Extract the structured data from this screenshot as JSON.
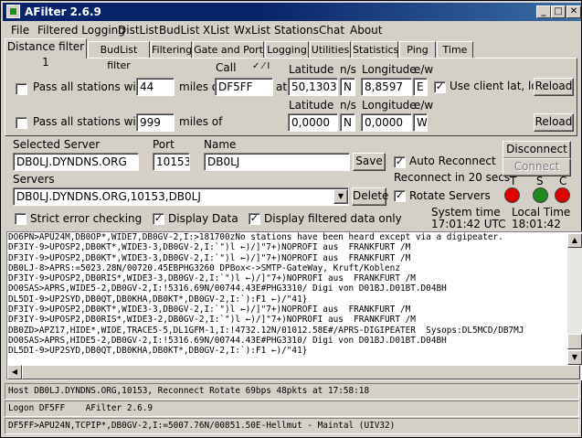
{
  "window": {
    "title": "AFilter 2.6.9"
  },
  "menu": [
    "File",
    "Filtered Logging",
    "DistList",
    "BudList",
    "XList",
    "WxList",
    "Stations",
    "Chat",
    "About"
  ],
  "tabs": [
    "Distance filter 1",
    "BudList filter",
    "Filtering",
    "Gate and Port",
    "Logging",
    "Utilities",
    "Statistics",
    "Ping",
    "Time"
  ],
  "distance": {
    "call_label": "Call",
    "call_hint": "✓ ⁄ I",
    "lat_label": "Latitude",
    "lon_label": "Longitude",
    "ns_label": "n/s",
    "ew_label": "e/w",
    "row1": {
      "pass_label": "Pass all stations within",
      "miles": "44",
      "miles_of": "miles of",
      "call": "DF5FF",
      "at": "at",
      "lat": "50,1303",
      "ns": "N",
      "lon": "8,8597",
      "ew": "E",
      "use_client_label": "Use client lat, lon",
      "use_client_checked": true,
      "reload": "Reload"
    },
    "row2": {
      "pass_label": "Pass all stations within",
      "miles": "999",
      "miles_of": "miles of",
      "lat": "0,0000",
      "ns": "N",
      "lon": "0,0000",
      "ew": "W",
      "reload": "Reload"
    }
  },
  "server": {
    "selected_label": "Selected Server",
    "selected_value": "DB0LJ.DYNDNS.ORG",
    "port_label": "Port",
    "port_value": "10153",
    "name_label": "Name",
    "name_value": "DB0LJ",
    "save_label": "Save",
    "servers_label": "Servers",
    "servers_value": "DB0LJ.DYNDNS.ORG,10153,DB0LJ",
    "delete_label": "Delete",
    "disconnect_label": "Disconnect",
    "connect_label": "Connect",
    "auto_reconnect_label": "Auto Reconnect",
    "reconnect_text": "Reconnect in 20 secs",
    "rotate_label": "Rotate Servers",
    "led_labels": [
      "T",
      "S",
      "C"
    ],
    "led_colors": [
      "#e00000",
      "#1e8a1e",
      "#e00000"
    ]
  },
  "options": {
    "strict_label": "Strict error checking",
    "display_data_label": "Display Data",
    "display_filtered_label": "Display filtered data only",
    "system_time_label": "System time",
    "system_time_value": "17:01:42 UTC",
    "local_time_label": "Local Time",
    "local_time_value": "18:01:42"
  },
  "log": [
    "DO6PN>APU24M,DB0OP*,WIDE7,DB0GV-2,I:>181700zNo stations have been heard except via a digipeater.",
    "DF3IY-9>UPOSP2,DB0KT*,WIDE3-3,DB0GV-2,I:`\")l ←)/]\"7+)NOPROFI aus  FRANKFURT /M",
    "DF3IY-9>UPOSP2,DB0KT*,WIDE3-3,DB0GV-2,I:`\")l ←)/]\"7+)NOPROFI aus  FRANKFURT /M",
    "DB0LJ-8>APRS:=5023.28N/00720.45EBPHG3260 DPBox<->SMTP-GateWay, Kruft/Koblenz",
    "DF3IY-9>UPOSP2,DB0RIS*,WIDE3-3,DB0GV-2,I:`\")l ←)/]\"7+)NOPROFI aus  FRANKFURT /M",
    "DO0SAS>APRS,WIDE5-2,DB0GV-2,I:!5316.69N/00744.43E#PHG3310/ Digi von D01BJ.D01BT.D04BH",
    "DL5DI-9>UP2SYD,DB0QT,DB0KHA,DB0KT*,DB0GV-2,I:`):F1 ←)/\"41}",
    "DF3IY-9>UPOSP2,DB0KT*,WIDE3-3,DB0GV-2,I:`\")l ←)/]\"7+)NOPROFI aus  FRANKFURT /M",
    "DF3IY-9>UPOSP2,DB0RIS*,WIDE3-2,DB0GV-2,I:`\")l ←)/]\"7+)NOPROFI aus  FRANKFURT /M",
    "DB0ZD>APZ17,HIDE*,WIDE,TRACE5-5,DL1GFM-1,I:!4732.12N/01012.58E#/APRS-DIGIPEATER  Sysops:DL5MCD/DB7MJ",
    "DO0SAS>APRS,HIDE5-2,DB0GV-2,I:!5316.69N/00744.43E#PHG3310/ Digi von D01BJ.D01BT.D04BH",
    "DL5DI-9>UP2SYD,DB0QT,DB0KHA,DB0KT*,DB0GV-2,I:`):F1 ←)/\"41}"
  ],
  "status": [
    "Host DB0LJ.DYNDNS.ORG,10153, Reconnect Rotate 69bps 48pkts at 17:58:18",
    "Logon DF5FF    AFilter 2.6.9",
    "DF5FF>APU24N,TCPIP*,DB0GV-2,I:=5007.76N/00851.50E-Hellmut - Maintal (UIV32)"
  ]
}
